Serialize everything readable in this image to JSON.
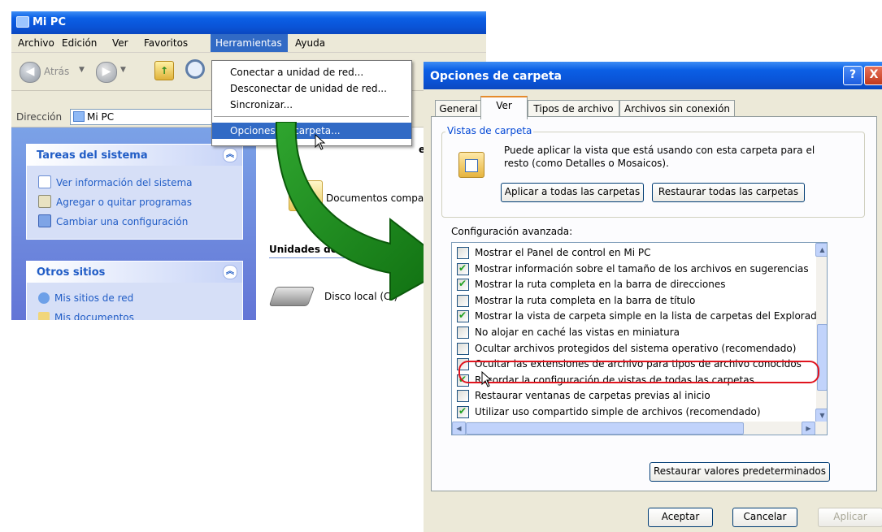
{
  "mypc_window": {
    "title": "Mi PC",
    "menu": [
      "Archivo",
      "Edición",
      "Ver",
      "Favoritos",
      "Herramientas",
      "Ayuda"
    ],
    "toolbar": {
      "back_label": "Atrás"
    },
    "address": {
      "label": "Dirección",
      "value": "Mi PC"
    },
    "system_tasks": {
      "title": "Tareas del sistema",
      "links": [
        "Ver información del sistema",
        "Agregar o quitar programas",
        "Cambiar una configuración"
      ]
    },
    "other_places": {
      "title": "Otros sitios",
      "links": [
        "Mis sitios de red",
        "Mis documentos"
      ]
    },
    "right_pane": {
      "files_header_fragment": "e",
      "shared_docs": "Documentos compar",
      "drives_header": "Unidades de disco duro",
      "local_disk": "Disco local (C:)"
    }
  },
  "tools_menu": {
    "items": [
      "Conectar a unidad de red...",
      "Desconectar de unidad de red...",
      "Sincronizar...",
      "Opciones de carpeta..."
    ]
  },
  "folder_options_dialog": {
    "title": "Opciones de carpeta",
    "help_label": "?",
    "close_label": "X",
    "tabs": [
      "General",
      "Ver",
      "Tipos de archivo",
      "Archivos sin conexión"
    ],
    "folder_views": {
      "legend": "Vistas de carpeta",
      "description": "Puede aplicar la vista que está usando con esta carpeta para el resto (como Detalles o Mosaicos).",
      "apply_all": "Aplicar a todas las carpetas",
      "reset_all": "Restaurar todas las carpetas"
    },
    "advanced_label": "Configuración avanzada:",
    "settings": [
      {
        "label": "Mostrar el Panel de control en Mi PC",
        "checked": false
      },
      {
        "label": "Mostrar información sobre el tamaño de los archivos en sugerencias",
        "checked": true
      },
      {
        "label": "Mostrar la ruta completa en la barra de direcciones",
        "checked": true
      },
      {
        "label": "Mostrar la ruta completa en la barra de título",
        "checked": false
      },
      {
        "label": "Mostrar la vista de carpeta simple en la lista de carpetas del Explorador",
        "checked": true
      },
      {
        "label": "No alojar en caché las vistas en miniatura",
        "checked": false
      },
      {
        "label": "Ocultar archivos protegidos del sistema operativo (recomendado)",
        "checked": false
      },
      {
        "label": "Ocultar las extensiones de archivo para tipos de archivo conocidos",
        "checked": false
      },
      {
        "label": "Recordar la configuración de vistas de todas las carpetas",
        "checked": true
      },
      {
        "label": "Restaurar ventanas de carpetas previas al inicio",
        "checked": false
      },
      {
        "label": "Utilizar uso compartido simple de archivos (recomendado)",
        "checked": true
      }
    ],
    "restore_defaults": "Restaurar valores predeterminados",
    "ok": "Aceptar",
    "cancel": "Cancelar",
    "apply": "Aplicar"
  },
  "colors": {
    "xp_blue": "#0a53d6",
    "menu_highlight": "#316ac5",
    "arrow_green": "#1f8a1f",
    "highlight_red": "#e0141e"
  }
}
